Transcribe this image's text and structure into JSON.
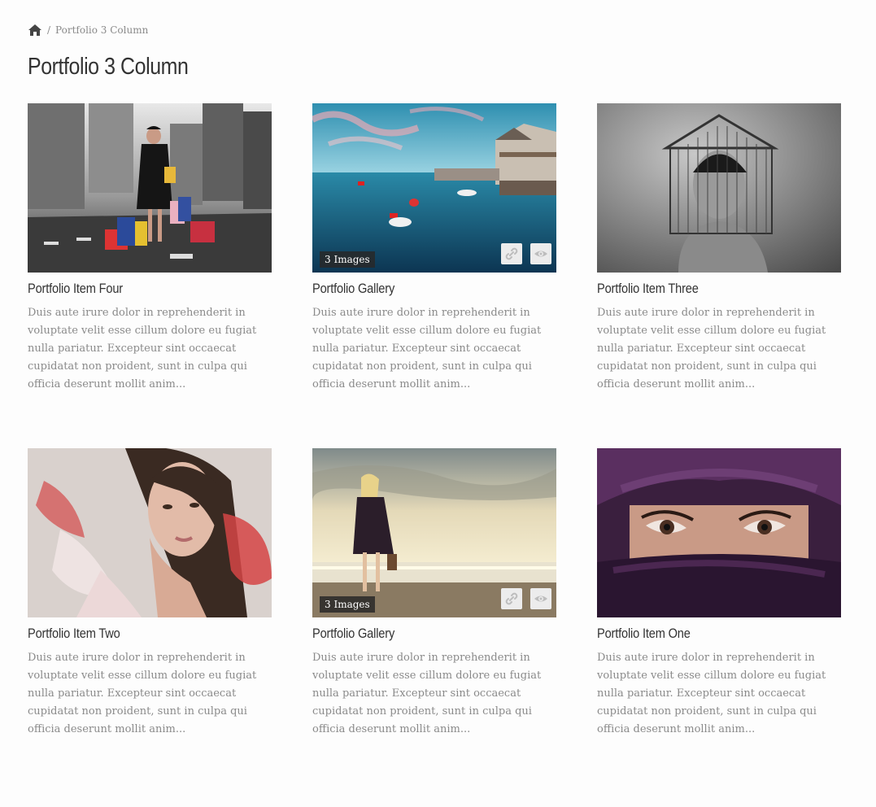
{
  "breadcrumb": {
    "home_icon": "home-icon",
    "separator": "/",
    "current": "Portfolio 3 Column"
  },
  "page_title": "Portfolio 3 Column",
  "items": [
    {
      "title": "Portfolio Item Four",
      "excerpt": "Duis aute irure dolor in reprehenderit in voluptate velit esse cillum dolore eu fugiat nulla pariatur. Excepteur sint occaecat cupidatat non proident, sunt in culpa qui officia deserunt mollit anim...",
      "image": "woman-with-shopping-bags-city-street",
      "badge": "",
      "actions": []
    },
    {
      "title": "Portfolio Gallery",
      "excerpt": "Duis aute irure dolor in reprehenderit in voluptate velit esse cillum dolore eu fugiat nulla pariatur. Excepteur sint occaecat cupidatat non proident, sunt in culpa qui officia deserunt mollit anim...",
      "image": "harbor-with-boats",
      "badge": "3 Images",
      "actions": [
        "link-icon",
        "eye-icon"
      ]
    },
    {
      "title": "Portfolio Item Three",
      "excerpt": "Duis aute irure dolor in reprehenderit in voluptate velit esse cillum dolore eu fugiat nulla pariatur. Excepteur sint occaecat cupidatat non proident, sunt in culpa qui officia deserunt mollit anim...",
      "image": "woman-with-birdcage-bw",
      "badge": "",
      "actions": []
    },
    {
      "title": "Portfolio Item Two",
      "excerpt": "Duis aute irure dolor in reprehenderit in voluptate velit esse cillum dolore eu fugiat nulla pariatur. Excepteur sint occaecat cupidatat non proident, sunt in culpa qui officia deserunt mollit anim...",
      "image": "woman-with-red-tulle-collar",
      "badge": "",
      "actions": []
    },
    {
      "title": "Portfolio Gallery",
      "excerpt": "Duis aute irure dolor in reprehenderit in voluptate velit esse cillum dolore eu fugiat nulla pariatur. Excepteur sint occaecat cupidatat non proident, sunt in culpa qui officia deserunt mollit anim...",
      "image": "woman-on-beach-sunset",
      "badge": "3 Images",
      "actions": [
        "link-icon",
        "eye-icon"
      ]
    },
    {
      "title": "Portfolio Item One",
      "excerpt": "Duis aute irure dolor in reprehenderit in voluptate velit esse cillum dolore eu fugiat nulla pariatur. Excepteur sint occaecat cupidatat non proident, sunt in culpa qui officia deserunt mollit anim...",
      "image": "woman-with-purple-veil",
      "badge": "",
      "actions": []
    }
  ]
}
